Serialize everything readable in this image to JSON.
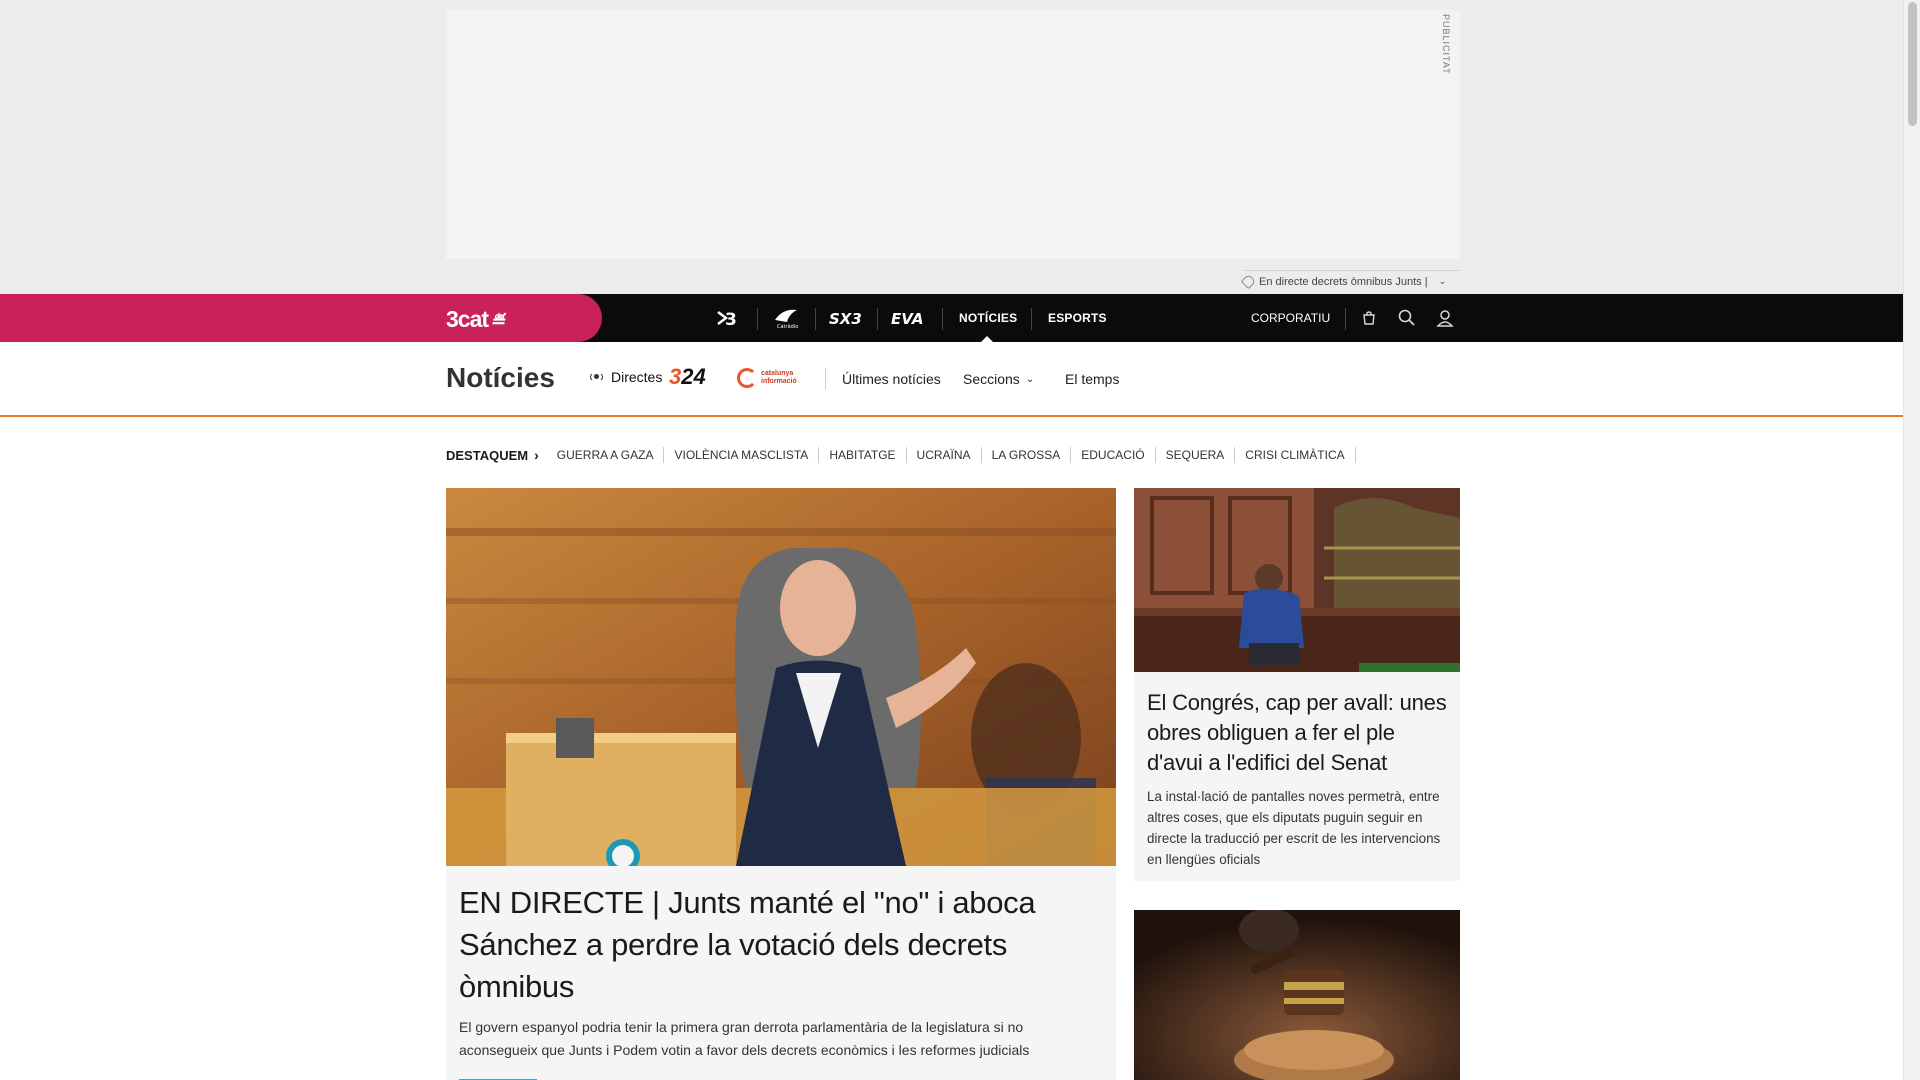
{
  "ad": {
    "label": "PUBLICITAT"
  },
  "live_ticker": {
    "text": "En directe decrets òmnibus Junts |"
  },
  "topnav": {
    "brand": "3cat",
    "channels": [
      {
        "name": "3",
        "icon": "tv3-logo"
      },
      {
        "name": "Catràdio",
        "icon": "catradio-logo"
      },
      {
        "name": "SX3",
        "icon": "sx3-logo"
      },
      {
        "name": "EVA",
        "icon": "eva-logo"
      }
    ],
    "links": [
      "NOTÍCIES",
      "ESPORTS"
    ],
    "active": "NOTÍCIES",
    "corporate": "CORPORATIU"
  },
  "sectionbar": {
    "title": "Notícies",
    "directes": "Directes",
    "logo_324": {
      "accent": "3",
      "rest": "24"
    },
    "logo_ci": {
      "line1": "catalunya",
      "line2": "informació"
    },
    "links": {
      "latest": "Últimes notícies",
      "sections": "Seccions",
      "weather": "El temps"
    }
  },
  "topics": {
    "label": "DESTAQUEM",
    "items": [
      "GUERRA A GAZA",
      "VIOLÈNCIA MASCLISTA",
      "HABITATGE",
      "UCRAÏNA",
      "LA GROSSA",
      "EDUCACIÓ",
      "SEQUERA",
      "CRISI CLIMÀTICA"
    ]
  },
  "lead": {
    "title": "EN DIRECTE | Junts manté el \"no\" i aboca Sánchez a perdre la votació dels decrets òmnibus",
    "summary": "El govern espanyol podria tenir la primera gran derrota parlamentària de la legislatura si no aconsegueix que Junts i Podem votin a favor dels decrets econòmics i les reformes judicials"
  },
  "side1": {
    "title": "El Congrés, cap per avall: unes obres obliguen a fer el ple d'avui a l'edifici del Senat",
    "summary": "La instal·lació de pantalles noves permetrà, entre altres coses, que els diputats puguin seguir en directe la traducció per escrit de les intervencions en llengües oficials"
  },
  "colors": {
    "brand": "#c9215a",
    "topnav_bg": "#0b0b0b",
    "section_underline": "#e87a2a",
    "accent_324": "#e8562a",
    "card_bg": "#f5f5f5"
  }
}
